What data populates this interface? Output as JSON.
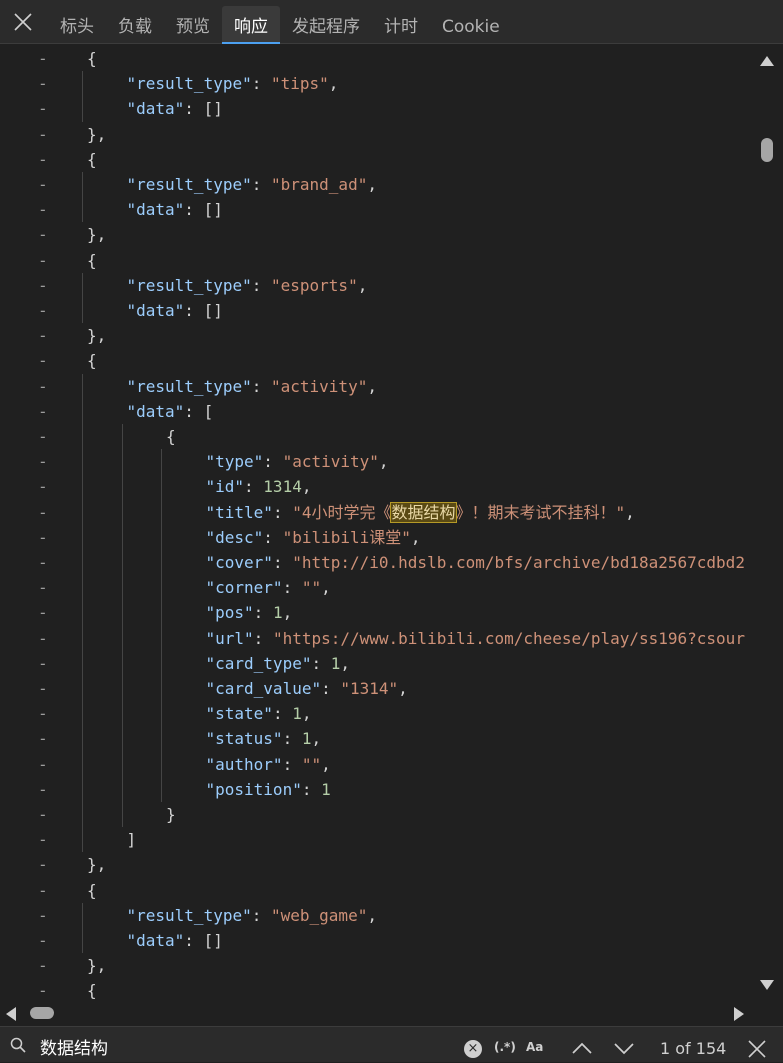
{
  "tabs": [
    {
      "label": "标头",
      "active": false
    },
    {
      "label": "负载",
      "active": false
    },
    {
      "label": "预览",
      "active": false
    },
    {
      "label": "响应",
      "active": true
    },
    {
      "label": "发起程序",
      "active": false
    },
    {
      "label": "计时",
      "active": false
    },
    {
      "label": "Cookie",
      "active": false
    }
  ],
  "icons": {
    "close_panel": "close-icon",
    "search": "search-icon",
    "clear": "clear-icon",
    "prev": "chevron-up-icon",
    "next": "chevron-down-icon",
    "close_search": "close-icon"
  },
  "code_lines": [
    {
      "indent": 0,
      "tokens": [
        [
          "p",
          "{"
        ]
      ]
    },
    {
      "indent": 1,
      "tokens": [
        [
          "k",
          "\"result_type\""
        ],
        [
          "p",
          ": "
        ],
        [
          "s",
          "\"tips\""
        ],
        [
          "p",
          ","
        ]
      ]
    },
    {
      "indent": 1,
      "tokens": [
        [
          "k",
          "\"data\""
        ],
        [
          "p",
          ": []"
        ]
      ]
    },
    {
      "indent": 0,
      "tokens": [
        [
          "p",
          "},"
        ]
      ]
    },
    {
      "indent": 0,
      "tokens": [
        [
          "p",
          "{"
        ]
      ]
    },
    {
      "indent": 1,
      "tokens": [
        [
          "k",
          "\"result_type\""
        ],
        [
          "p",
          ": "
        ],
        [
          "s",
          "\"brand_ad\""
        ],
        [
          "p",
          ","
        ]
      ]
    },
    {
      "indent": 1,
      "tokens": [
        [
          "k",
          "\"data\""
        ],
        [
          "p",
          ": []"
        ]
      ]
    },
    {
      "indent": 0,
      "tokens": [
        [
          "p",
          "},"
        ]
      ]
    },
    {
      "indent": 0,
      "tokens": [
        [
          "p",
          "{"
        ]
      ]
    },
    {
      "indent": 1,
      "tokens": [
        [
          "k",
          "\"result_type\""
        ],
        [
          "p",
          ": "
        ],
        [
          "s",
          "\"esports\""
        ],
        [
          "p",
          ","
        ]
      ]
    },
    {
      "indent": 1,
      "tokens": [
        [
          "k",
          "\"data\""
        ],
        [
          "p",
          ": []"
        ]
      ]
    },
    {
      "indent": 0,
      "tokens": [
        [
          "p",
          "},"
        ]
      ]
    },
    {
      "indent": 0,
      "tokens": [
        [
          "p",
          "{"
        ]
      ]
    },
    {
      "indent": 1,
      "tokens": [
        [
          "k",
          "\"result_type\""
        ],
        [
          "p",
          ": "
        ],
        [
          "s",
          "\"activity\""
        ],
        [
          "p",
          ","
        ]
      ]
    },
    {
      "indent": 1,
      "tokens": [
        [
          "k",
          "\"data\""
        ],
        [
          "p",
          ": ["
        ]
      ]
    },
    {
      "indent": 2,
      "tokens": [
        [
          "p",
          "{"
        ]
      ]
    },
    {
      "indent": 3,
      "tokens": [
        [
          "k",
          "\"type\""
        ],
        [
          "p",
          ": "
        ],
        [
          "s",
          "\"activity\""
        ],
        [
          "p",
          ","
        ]
      ]
    },
    {
      "indent": 3,
      "tokens": [
        [
          "k",
          "\"id\""
        ],
        [
          "p",
          ": "
        ],
        [
          "n",
          "1314"
        ],
        [
          "p",
          ","
        ]
      ]
    },
    {
      "indent": 3,
      "tokens": [
        [
          "k",
          "\"title\""
        ],
        [
          "p",
          ": "
        ],
        [
          "s",
          "\"4小时学完《"
        ],
        [
          "hl",
          "数据结构"
        ],
        [
          "s",
          "》！期末考试不挂科！\""
        ],
        [
          "p",
          ","
        ]
      ]
    },
    {
      "indent": 3,
      "tokens": [
        [
          "k",
          "\"desc\""
        ],
        [
          "p",
          ": "
        ],
        [
          "s",
          "\"bilibili课堂\""
        ],
        [
          "p",
          ","
        ]
      ]
    },
    {
      "indent": 3,
      "tokens": [
        [
          "k",
          "\"cover\""
        ],
        [
          "p",
          ": "
        ],
        [
          "s",
          "\"http://i0.hdslb.com/bfs/archive/bd18a2567cdbd2"
        ]
      ]
    },
    {
      "indent": 3,
      "tokens": [
        [
          "k",
          "\"corner\""
        ],
        [
          "p",
          ": "
        ],
        [
          "s",
          "\"\""
        ],
        [
          "p",
          ","
        ]
      ]
    },
    {
      "indent": 3,
      "tokens": [
        [
          "k",
          "\"pos\""
        ],
        [
          "p",
          ": "
        ],
        [
          "n",
          "1"
        ],
        [
          "p",
          ","
        ]
      ]
    },
    {
      "indent": 3,
      "tokens": [
        [
          "k",
          "\"url\""
        ],
        [
          "p",
          ": "
        ],
        [
          "s",
          "\"https://www.bilibili.com/cheese/play/ss196?csour"
        ]
      ]
    },
    {
      "indent": 3,
      "tokens": [
        [
          "k",
          "\"card_type\""
        ],
        [
          "p",
          ": "
        ],
        [
          "n",
          "1"
        ],
        [
          "p",
          ","
        ]
      ]
    },
    {
      "indent": 3,
      "tokens": [
        [
          "k",
          "\"card_value\""
        ],
        [
          "p",
          ": "
        ],
        [
          "s",
          "\"1314\""
        ],
        [
          "p",
          ","
        ]
      ]
    },
    {
      "indent": 3,
      "tokens": [
        [
          "k",
          "\"state\""
        ],
        [
          "p",
          ": "
        ],
        [
          "n",
          "1"
        ],
        [
          "p",
          ","
        ]
      ]
    },
    {
      "indent": 3,
      "tokens": [
        [
          "k",
          "\"status\""
        ],
        [
          "p",
          ": "
        ],
        [
          "n",
          "1"
        ],
        [
          "p",
          ","
        ]
      ]
    },
    {
      "indent": 3,
      "tokens": [
        [
          "k",
          "\"author\""
        ],
        [
          "p",
          ": "
        ],
        [
          "s",
          "\"\""
        ],
        [
          "p",
          ","
        ]
      ]
    },
    {
      "indent": 3,
      "tokens": [
        [
          "k",
          "\"position\""
        ],
        [
          "p",
          ": "
        ],
        [
          "n",
          "1"
        ]
      ]
    },
    {
      "indent": 2,
      "tokens": [
        [
          "p",
          "}"
        ]
      ]
    },
    {
      "indent": 1,
      "tokens": [
        [
          "p",
          "]"
        ]
      ]
    },
    {
      "indent": 0,
      "tokens": [
        [
          "p",
          "},"
        ]
      ]
    },
    {
      "indent": 0,
      "tokens": [
        [
          "p",
          "{"
        ]
      ]
    },
    {
      "indent": 1,
      "tokens": [
        [
          "k",
          "\"result_type\""
        ],
        [
          "p",
          ": "
        ],
        [
          "s",
          "\"web_game\""
        ],
        [
          "p",
          ","
        ]
      ]
    },
    {
      "indent": 1,
      "tokens": [
        [
          "k",
          "\"data\""
        ],
        [
          "p",
          ": []"
        ]
      ]
    },
    {
      "indent": 0,
      "tokens": [
        [
          "p",
          "},"
        ]
      ]
    },
    {
      "indent": 0,
      "tokens": [
        [
          "p",
          "{"
        ]
      ]
    }
  ],
  "fold_marker": "-",
  "search": {
    "query": "数据结构",
    "clear_label": "×",
    "regex_label": "(.*)",
    "case_label": "Aa",
    "result_count": "1 of 154"
  }
}
